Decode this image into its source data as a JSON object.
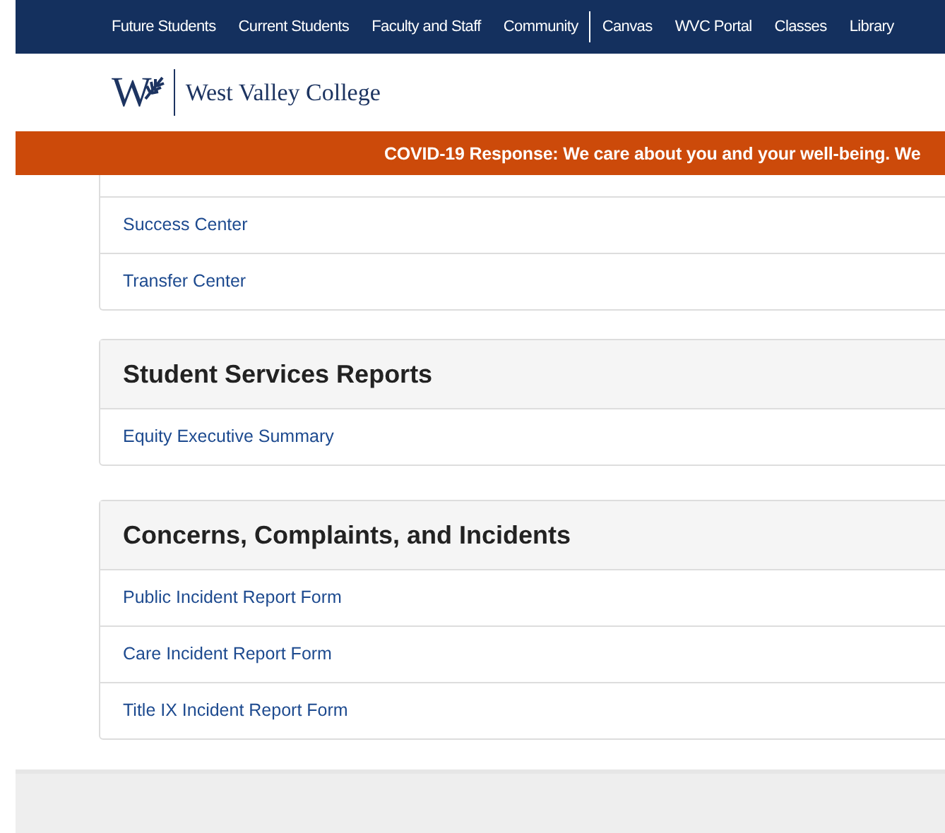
{
  "top_nav": {
    "items": [
      {
        "label": "Future Students",
        "divider_after": false
      },
      {
        "label": "Current Students",
        "divider_after": false
      },
      {
        "label": "Faculty and Staff",
        "divider_after": false
      },
      {
        "label": "Community",
        "divider_after": true
      },
      {
        "label": "Canvas",
        "divider_after": false
      },
      {
        "label": "WVC Portal",
        "divider_after": false
      },
      {
        "label": "Classes",
        "divider_after": false
      },
      {
        "label": "Library",
        "divider_after": false
      }
    ]
  },
  "logo": {
    "mark": "W",
    "name": "West Valley College"
  },
  "alert_banner": {
    "text": "COVID-19 Response: We care about you and your well-being. We"
  },
  "panels": [
    {
      "links": [
        "Success Center",
        "Transfer Center"
      ]
    },
    {
      "heading": "Student Services Reports",
      "links": [
        "Equity Executive Summary"
      ]
    },
    {
      "heading": "Concerns, Complaints, and Incidents",
      "links": [
        "Public Incident Report Form",
        "Care Incident Report Form",
        "Title IX Incident Report Form"
      ]
    }
  ]
}
